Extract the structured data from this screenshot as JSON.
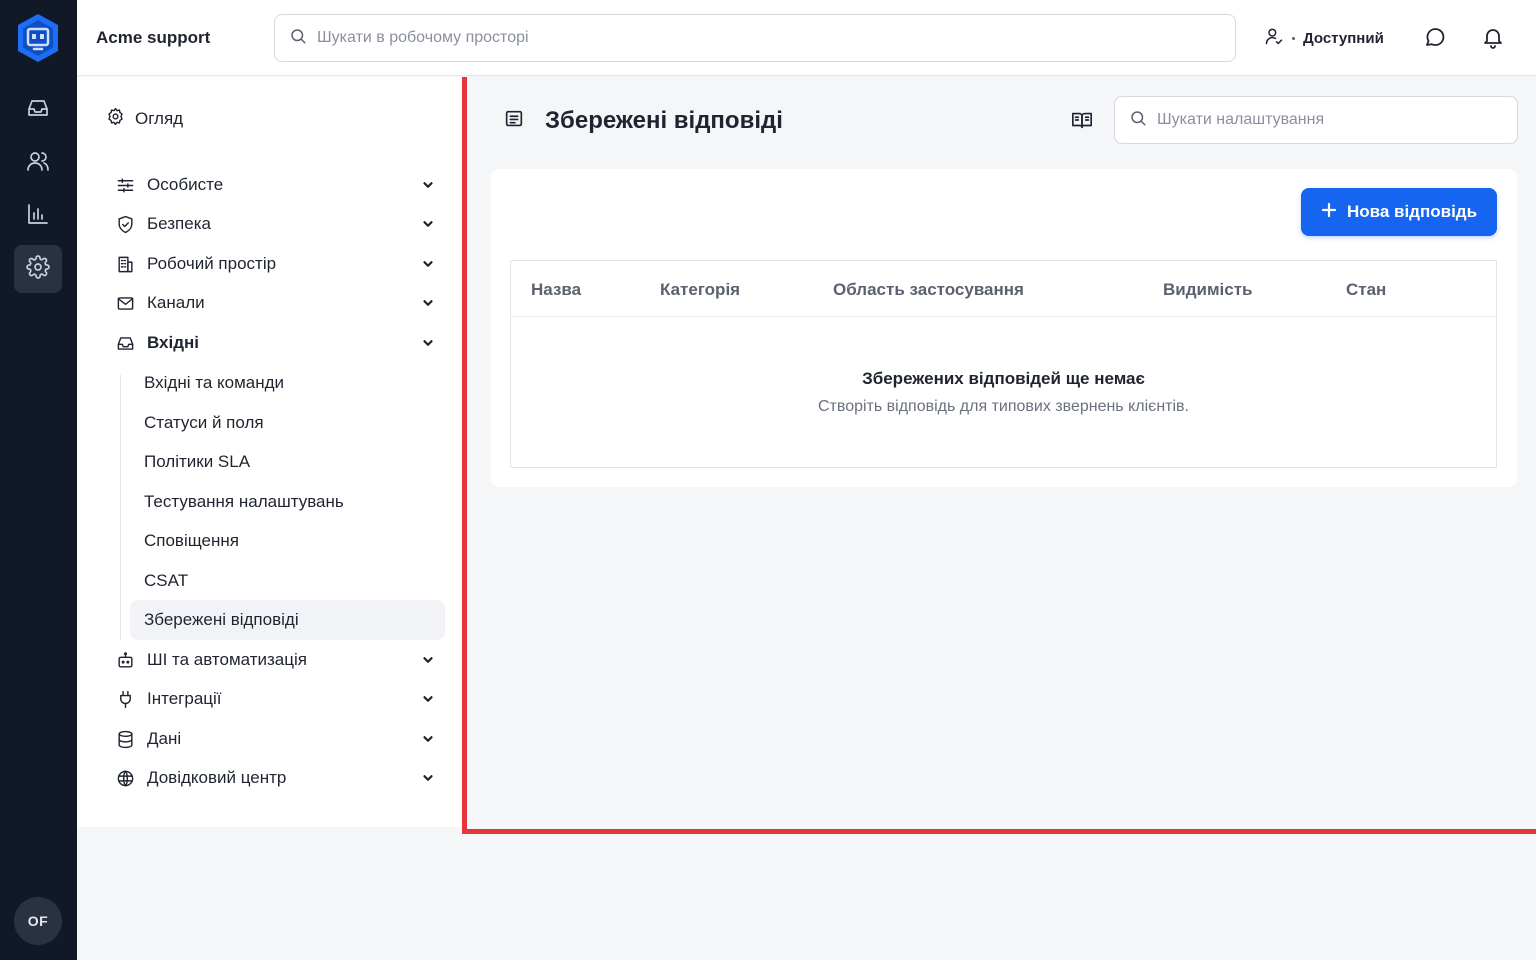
{
  "rail": {
    "avatar_initials": "OF",
    "items": [
      {
        "name": "inbox-icon"
      },
      {
        "name": "contacts-icon"
      },
      {
        "name": "reports-icon"
      },
      {
        "name": "settings-icon",
        "active": true
      }
    ]
  },
  "topbar": {
    "workspace_name": "Acme support",
    "search_placeholder": "Шукати в робочому просторі",
    "status_label": "Доступний"
  },
  "nav": {
    "overview_label": "Огляд",
    "items": [
      {
        "label": "Особисте",
        "icon": "sliders-icon"
      },
      {
        "label": "Безпека",
        "icon": "shield-icon"
      },
      {
        "label": "Робочий простір",
        "icon": "building-icon"
      },
      {
        "label": "Канали",
        "icon": "mail-icon"
      },
      {
        "label": "Вхідні",
        "icon": "inbox-icon",
        "expanded": true
      },
      {
        "label": "ШІ та автоматизація",
        "icon": "robot-icon"
      },
      {
        "label": "Інтеграції",
        "icon": "plug-icon"
      },
      {
        "label": "Дані",
        "icon": "database-icon"
      },
      {
        "label": "Довідковий центр",
        "icon": "globe-icon"
      }
    ],
    "inbox_subitems": [
      "Вхідні та команди",
      "Статуси й поля",
      "Політики SLA",
      "Тестування налаштувань",
      "Сповіщення",
      "CSAT",
      "Збережені відповіді"
    ],
    "active_subitem": "Збережені відповіді"
  },
  "page": {
    "title": "Збережені відповіді",
    "settings_search_placeholder": "Шукати налаштування",
    "new_button_label": "Нова відповідь",
    "table_headers": [
      "Назва",
      "Категорія",
      "Область застосування",
      "Видимість",
      "Стан"
    ],
    "empty_title": "Збережених відповідей ще немає",
    "empty_subtitle": "Створіть відповідь для типових звернень клієнтів."
  },
  "colors": {
    "rail_bg": "#111827",
    "accent": "#1565f0",
    "highlight_border": "#e5363d"
  }
}
